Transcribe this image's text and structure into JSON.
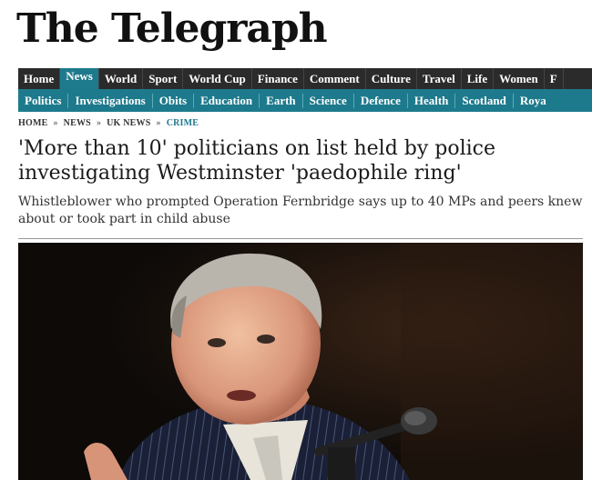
{
  "masthead": {
    "logo_text": "The Telegraph"
  },
  "primary_nav": {
    "items": [
      {
        "label": "Home",
        "active": false
      },
      {
        "label": "News",
        "active": true
      },
      {
        "label": "World",
        "active": false
      },
      {
        "label": "Sport",
        "active": false
      },
      {
        "label": "World Cup",
        "active": false
      },
      {
        "label": "Finance",
        "active": false
      },
      {
        "label": "Comment",
        "active": false
      },
      {
        "label": "Culture",
        "active": false
      },
      {
        "label": "Travel",
        "active": false
      },
      {
        "label": "Life",
        "active": false
      },
      {
        "label": "Women",
        "active": false
      },
      {
        "label": "F",
        "active": false
      }
    ]
  },
  "secondary_nav": {
    "items": [
      "Politics",
      "Investigations",
      "Obits",
      "Education",
      "Earth",
      "Science",
      "Defence",
      "Health",
      "Scotland",
      "Roya"
    ]
  },
  "breadcrumb": {
    "items": [
      "HOME",
      "NEWS",
      "UK NEWS",
      "CRIME"
    ],
    "separator": "»"
  },
  "article": {
    "headline": "'More than 10' politicians on list held by police investigating Westminster 'paedophile ring'",
    "standfirst": "Whistleblower who prompted Operation Fernbridge says up to 40 MPs and peers knew about or took part in child abuse"
  },
  "colors": {
    "nav_dark": "#2b2b2b",
    "accent_teal": "#1d7a8c"
  }
}
